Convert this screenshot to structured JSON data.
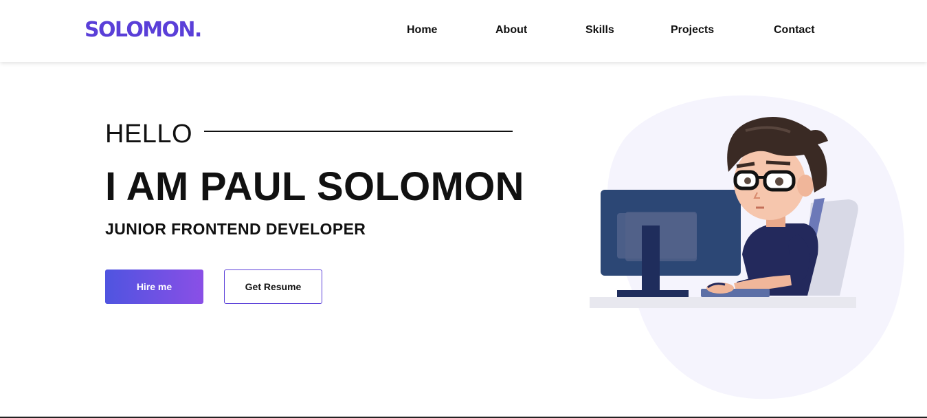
{
  "brand": {
    "logo_text": "SOLOMON.",
    "accent_color": "#5a3fd8"
  },
  "nav": {
    "links": [
      {
        "label": "Home"
      },
      {
        "label": "About"
      },
      {
        "label": "Skills"
      },
      {
        "label": "Projects"
      },
      {
        "label": "Contact"
      }
    ]
  },
  "hero": {
    "greeting": "HELLO",
    "name_line": "I AM PAUL SOLOMON",
    "role": "JUNIOR FRONTEND DEVELOPER",
    "primary_button": "Hire me",
    "secondary_button": "Get Resume",
    "button_gradient": [
      "#4f54e0",
      "#8a4fe6"
    ]
  },
  "illustration": {
    "icon": "developer-at-computer-illustration"
  }
}
